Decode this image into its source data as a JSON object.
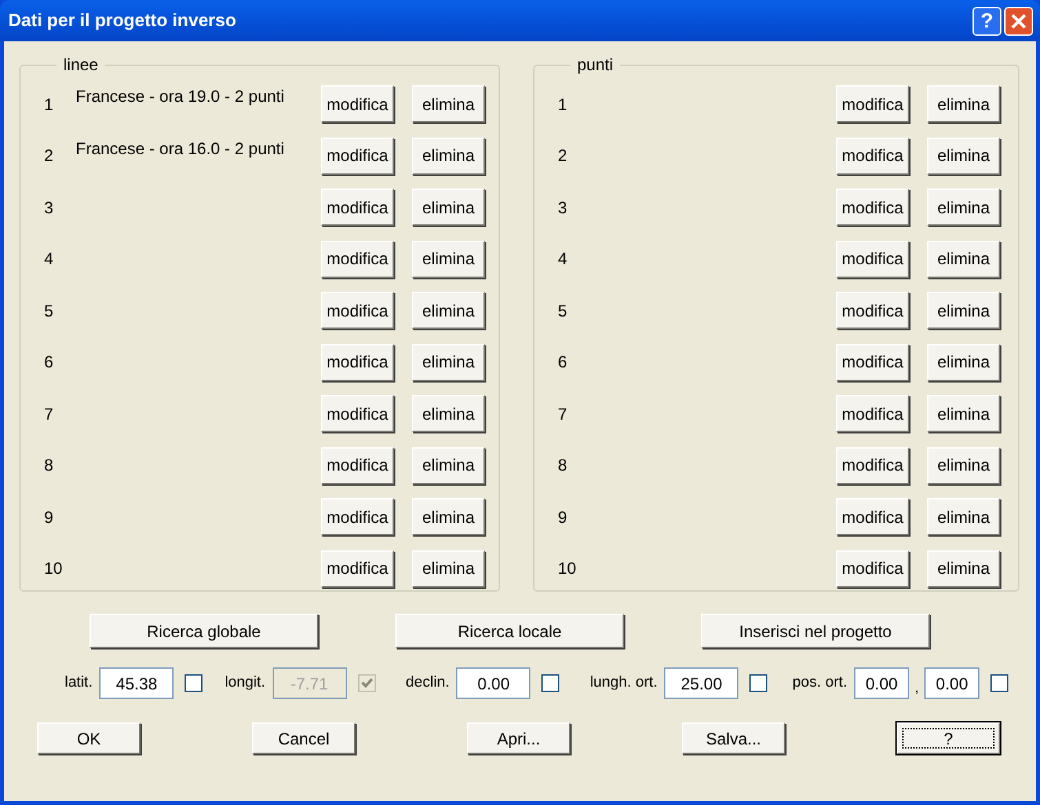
{
  "window": {
    "title": "Dati per il progetto inverso",
    "title_buttons": [
      "?"
    ]
  },
  "groups": [
    {
      "label": "linee",
      "rows": [
        {
          "number": "1",
          "text": "Francese - ora 19.0 - 2 punti",
          "buttons": [
            "modifica",
            "elimina"
          ]
        },
        {
          "number": "2",
          "text": "Francese - ora 16.0 - 2 punti",
          "buttons": [
            "modifica",
            "elimina"
          ]
        },
        {
          "number": "3",
          "buttons": [
            "modifica",
            "elimina"
          ]
        },
        {
          "number": "4",
          "buttons": [
            "modifica",
            "elimina"
          ]
        },
        {
          "number": "5",
          "buttons": [
            "modifica",
            "elimina"
          ]
        },
        {
          "number": "6",
          "buttons": [
            "modifica",
            "elimina"
          ]
        },
        {
          "number": "7",
          "buttons": [
            "modifica",
            "elimina"
          ]
        },
        {
          "number": "8",
          "buttons": [
            "modifica",
            "elimina"
          ]
        },
        {
          "number": "9",
          "buttons": [
            "modifica",
            "elimina"
          ]
        },
        {
          "number": "10",
          "buttons": [
            "modifica",
            "elimina"
          ]
        }
      ]
    },
    {
      "label": "punti",
      "rows": [
        {
          "number": "1",
          "buttons": [
            "modifica",
            "elimina"
          ]
        },
        {
          "number": "2",
          "buttons": [
            "modifica",
            "elimina"
          ]
        },
        {
          "number": "3",
          "buttons": [
            "modifica",
            "elimina"
          ]
        },
        {
          "number": "4",
          "buttons": [
            "modifica",
            "elimina"
          ]
        },
        {
          "number": "5",
          "buttons": [
            "modifica",
            "elimina"
          ]
        },
        {
          "number": "6",
          "buttons": [
            "modifica",
            "elimina"
          ]
        },
        {
          "number": "7",
          "buttons": [
            "modifica",
            "elimina"
          ]
        },
        {
          "number": "8",
          "buttons": [
            "modifica",
            "elimina"
          ]
        },
        {
          "number": "9",
          "buttons": [
            "modifica",
            "elimina"
          ]
        },
        {
          "number": "10",
          "buttons": [
            "modifica",
            "elimina"
          ]
        }
      ]
    }
  ],
  "search_buttons": [
    "Ricerca globale",
    "Ricerca locale",
    "Inserisci nel progetto"
  ],
  "fields": [
    {
      "label": "latit.",
      "values": [
        "45.38"
      ],
      "disabled": false,
      "checked": false
    },
    {
      "label": "longit.",
      "values": [
        "-7.71"
      ],
      "disabled": true,
      "checked": true
    },
    {
      "label": "declin.",
      "values": [
        "0.00"
      ],
      "disabled": false,
      "checked": false
    },
    {
      "label": "lungh. ort.",
      "values": [
        "25.00"
      ],
      "disabled": false,
      "checked": false
    },
    {
      "label": "pos. ort.",
      "values": [
        "0.00",
        "0.00"
      ],
      "separator": ",",
      "disabled": false,
      "checked": false
    }
  ],
  "buttons": [
    {
      "label": "OK",
      "default": false
    },
    {
      "label": "Cancel",
      "default": false
    },
    {
      "label": "Apri...",
      "default": false
    },
    {
      "label": "Salva...",
      "default": false
    },
    {
      "label": "?",
      "default": true
    }
  ]
}
